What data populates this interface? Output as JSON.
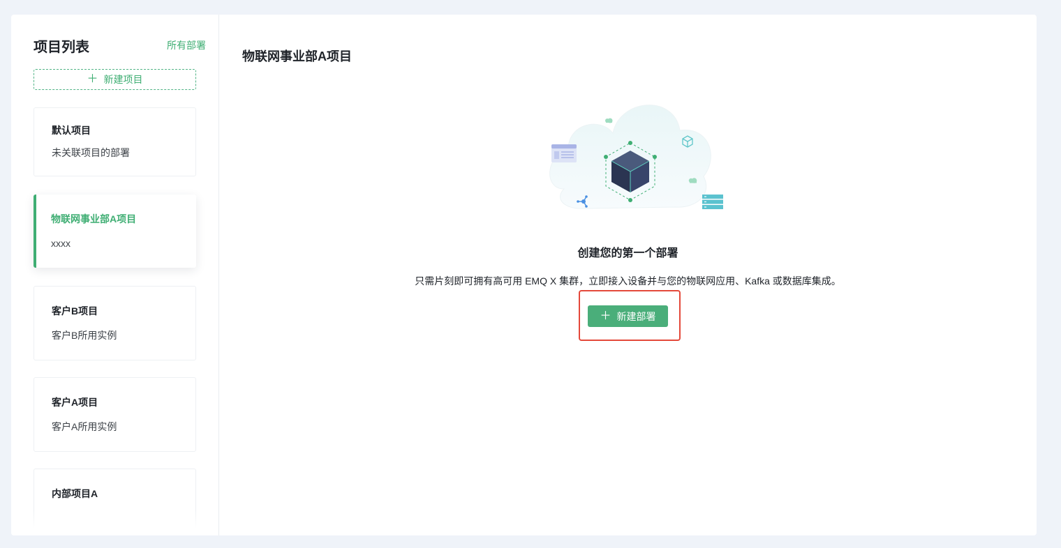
{
  "sidebar": {
    "title": "项目列表",
    "all_deployments_link": "所有部署",
    "new_project_label": "新建项目",
    "projects": [
      {
        "name": "默认项目",
        "desc": "未关联项目的部署"
      },
      {
        "name": "物联网事业部A项目",
        "desc": "xxxx",
        "active": true
      },
      {
        "name": "客户B项目",
        "desc": "客户B所用实例"
      },
      {
        "name": "客户A项目",
        "desc": "客户A所用实例"
      },
      {
        "name": "内部项目A",
        "desc": ""
      }
    ]
  },
  "main": {
    "title": "物联网事业部A项目",
    "empty_title": "创建您的第一个部署",
    "empty_desc": "只需片刻即可拥有高可用 EMQ X 集群，立即接入设备并与您的物联网应用、Kafka 或数据库集成。",
    "new_deployment_label": "新建部署"
  },
  "colors": {
    "accent": "#3fae73",
    "button": "#4aae7a",
    "highlight": "#e4483a",
    "background": "#eff3f9"
  },
  "icons": {
    "add": "plus-icon",
    "illustration": "cloud-cube-illustration"
  }
}
